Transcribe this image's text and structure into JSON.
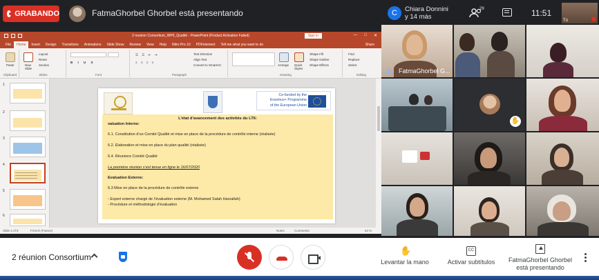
{
  "meeting": {
    "recording_label": "GRABANDO",
    "presenter_banner": "FatmaGhorbel Ghorbel está presentando",
    "host_initial": "C",
    "host_name_line1": "Chiara Donnini",
    "host_name_line2": "y 14 más",
    "people_count": "29",
    "time": "11:51",
    "self_label": "Tú",
    "meeting_name": "2 réunion Consortium",
    "actions": {
      "raise_hand": "Levantar la mano",
      "captions": "Activar subtítulos",
      "presenting_line1": "FatmaGhorbel Ghorbel",
      "presenting_line2": "está presentando"
    },
    "captions_glyph": "CC",
    "accent_red": "#d93025",
    "accent_blue": "#1a73e8"
  },
  "ppt": {
    "window_title": "2 reunion Consortium_WP6_Qualité  -  PowerPoint (Product Activation Failed)",
    "sign_in": "Sign in",
    "menu": [
      "File",
      "Home",
      "Insert",
      "Design",
      "Transitions",
      "Animations",
      "Slide Show",
      "Review",
      "View",
      "Help",
      "Nitro Pro 10",
      "PDFelement",
      "Tell me what you want to do"
    ],
    "share": "Share",
    "ribbon": {
      "clipboard": "Clipboard",
      "paste": "Paste",
      "new_slide_line1": "New",
      "new_slide_line2": "Slide",
      "layout": "Layout",
      "reset": "Reset",
      "section": "Section",
      "slides": "Slides",
      "font": "Font",
      "paragraph": "Paragraph",
      "text_direction": "Text Direction",
      "align_text": "Align Text",
      "convert_smartart": "Convert to SmartArt",
      "arrange": "Arrange",
      "quick_styles_line1": "Quick",
      "quick_styles_line2": "Styles",
      "shape_fill": "Shape Fill",
      "shape_outline": "Shape Outline",
      "shape_effects": "Shape Effects",
      "drawing": "Drawing",
      "find": "Find",
      "replace": "Replace",
      "select": "Select",
      "editing": "Editing"
    },
    "thumb_numbers": [
      "1",
      "2",
      "3",
      "4",
      "5",
      "6"
    ],
    "status": {
      "slide_of": "Slide 4 of 9",
      "language": "French (France)",
      "notes": "Notes",
      "comments": "Comments",
      "zoom": "64 %"
    },
    "slide": {
      "erasmus_line1": "Co-funded by the",
      "erasmus_line2": "Erasmus+ Programme",
      "erasmus_line3": "of the European Union",
      "heading": "L'état d'avancement des activités du LT6:",
      "lines": [
        "valuation Interne:",
        "6.1. Constitution d’un Comité Qualité et mise en place de la procédure de contrôle interne (réalisée)",
        "6.2. Elaboration et mise en place du plan qualité (réalisée)",
        "6.4. Réunions Comité Qualité",
        "La première réunion s’est tenue en ligne le 16/07/2020",
        "Evaluation Externe:",
        "6.3 Mise en place de la procédure de contrôle externe",
        "-   Expert externe chargé de l’évaluation externe (M. Mohamed Salah Harzallah)",
        "-   Procédure et méthodologie d’évaluation"
      ]
    }
  },
  "participants": [
    {
      "name": "FatmaGhorbel G...",
      "speaking": true
    },
    {
      "name": ""
    },
    {
      "name": ""
    },
    {
      "name": ""
    },
    {
      "name": ""
    },
    {
      "name": "",
      "hand_raised": true
    },
    {
      "name": ""
    },
    {
      "name": ""
    },
    {
      "name": ""
    },
    {
      "name": ""
    },
    {
      "name": ""
    },
    {
      "name": ""
    },
    {
      "name": ""
    },
    {
      "name": ""
    },
    {
      "name": ""
    }
  ]
}
